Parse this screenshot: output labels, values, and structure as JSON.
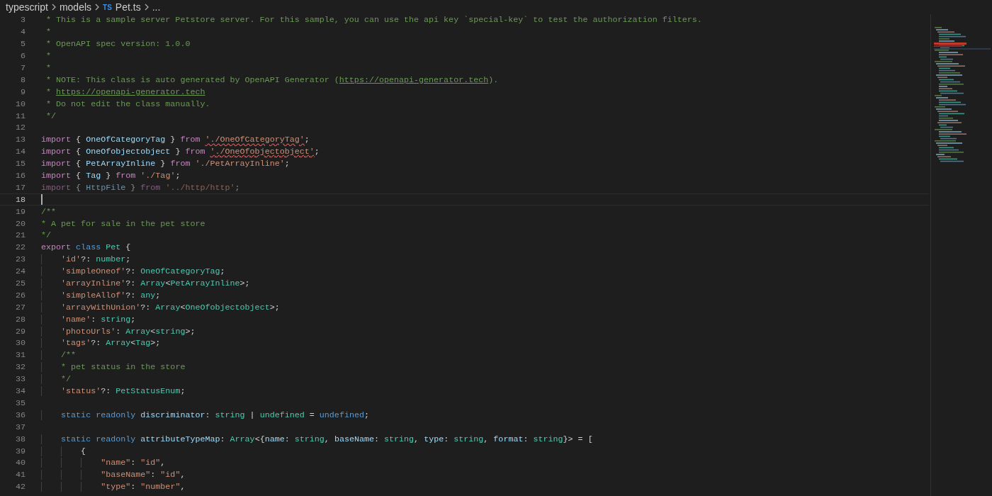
{
  "breadcrumbs": {
    "items": [
      {
        "label": "typescript"
      },
      {
        "label": "models"
      },
      {
        "label": "Pet.ts",
        "badge": "TS"
      },
      {
        "label": "..."
      }
    ]
  },
  "editor": {
    "lines": [
      {
        "number": "3",
        "tokens": [
          {
            "kind": "comment",
            "text": " * This is a sample server Petstore server. For this sample, you can use the api key `special-key` to test the authorization filters."
          }
        ]
      },
      {
        "number": "4",
        "tokens": [
          {
            "kind": "comment",
            "text": " *"
          }
        ]
      },
      {
        "number": "5",
        "tokens": [
          {
            "kind": "comment",
            "text": " * OpenAPI spec version: 1.0.0"
          }
        ]
      },
      {
        "number": "6",
        "tokens": [
          {
            "kind": "comment",
            "text": " *"
          }
        ]
      },
      {
        "number": "7",
        "tokens": [
          {
            "kind": "comment",
            "text": " *"
          }
        ]
      },
      {
        "number": "8",
        "tokens": [
          {
            "kind": "comment",
            "text": " * NOTE: This class is auto generated by OpenAPI Generator ("
          },
          {
            "kind": "link",
            "text": "https://openapi-generator.tech"
          },
          {
            "kind": "comment",
            "text": ")."
          }
        ]
      },
      {
        "number": "9",
        "tokens": [
          {
            "kind": "comment",
            "text": " * "
          },
          {
            "kind": "link",
            "text": "https://openapi-generator.tech"
          }
        ]
      },
      {
        "number": "10",
        "tokens": [
          {
            "kind": "comment",
            "text": " * Do not edit the class manually."
          }
        ]
      },
      {
        "number": "11",
        "tokens": [
          {
            "kind": "comment",
            "text": " */"
          }
        ]
      },
      {
        "number": "12"
      },
      {
        "number": "13",
        "tokens": [
          {
            "kind": "keyword",
            "text": "import"
          },
          {
            "kind": "punct",
            "text": " { "
          },
          {
            "kind": "variable",
            "text": "OneOfCategoryTag"
          },
          {
            "kind": "punct",
            "text": " } "
          },
          {
            "kind": "keyword",
            "text": "from "
          },
          {
            "kind": "error",
            "text": "'./OneOfCategoryTag'"
          },
          {
            "kind": "punct",
            "text": ";"
          }
        ]
      },
      {
        "number": "14",
        "tokens": [
          {
            "kind": "keyword",
            "text": "import"
          },
          {
            "kind": "punct",
            "text": " { "
          },
          {
            "kind": "variable",
            "text": "OneOfobjectobject"
          },
          {
            "kind": "punct",
            "text": " } "
          },
          {
            "kind": "keyword",
            "text": "from "
          },
          {
            "kind": "error",
            "text": "'./OneOfobjectobject'"
          },
          {
            "kind": "punct",
            "text": ";"
          }
        ]
      },
      {
        "number": "15",
        "tokens": [
          {
            "kind": "keyword",
            "text": "import"
          },
          {
            "kind": "punct",
            "text": " { "
          },
          {
            "kind": "variable",
            "text": "PetArrayInline"
          },
          {
            "kind": "punct",
            "text": " } "
          },
          {
            "kind": "keyword",
            "text": "from "
          },
          {
            "kind": "string",
            "text": "'./PetArrayInline'"
          },
          {
            "kind": "punct",
            "text": ";"
          }
        ]
      },
      {
        "number": "16",
        "tokens": [
          {
            "kind": "keyword",
            "text": "import"
          },
          {
            "kind": "punct",
            "text": " { "
          },
          {
            "kind": "variable",
            "text": "Tag"
          },
          {
            "kind": "punct",
            "text": " } "
          },
          {
            "kind": "keyword",
            "text": "from "
          },
          {
            "kind": "string",
            "text": "'./Tag'"
          },
          {
            "kind": "punct",
            "text": ";"
          }
        ]
      },
      {
        "number": "17",
        "unused": true,
        "tokens": [
          {
            "kind": "keyword",
            "text": "import"
          },
          {
            "kind": "punct",
            "text": " { "
          },
          {
            "kind": "variable",
            "text": "HttpFile"
          },
          {
            "kind": "punct",
            "text": " } "
          },
          {
            "kind": "keyword",
            "text": "from "
          },
          {
            "kind": "string",
            "text": "'../http/http'"
          },
          {
            "kind": "punct",
            "text": ";"
          }
        ]
      },
      {
        "number": "18",
        "current": true
      },
      {
        "number": "19",
        "tokens": [
          {
            "kind": "comment",
            "text": "/**"
          }
        ]
      },
      {
        "number": "20",
        "tokens": [
          {
            "kind": "comment",
            "text": "* A pet for sale in the pet store"
          }
        ]
      },
      {
        "number": "21",
        "tokens": [
          {
            "kind": "comment",
            "text": "*/"
          }
        ]
      },
      {
        "number": "22",
        "tokens": [
          {
            "kind": "keyword",
            "text": "export "
          },
          {
            "kind": "storage",
            "text": "class "
          },
          {
            "kind": "type",
            "text": "Pet"
          },
          {
            "kind": "punct",
            "text": " {"
          }
        ]
      },
      {
        "number": "23",
        "tokens": [
          {
            "kind": "string",
            "text": "    'id'"
          },
          {
            "kind": "punct",
            "text": "?: "
          },
          {
            "kind": "type",
            "text": "number"
          },
          {
            "kind": "punct",
            "text": ";"
          }
        ]
      },
      {
        "number": "24",
        "tokens": [
          {
            "kind": "string",
            "text": "    'simpleOneof'"
          },
          {
            "kind": "punct",
            "text": "?: "
          },
          {
            "kind": "type",
            "text": "OneOfCategoryTag"
          },
          {
            "kind": "punct",
            "text": ";"
          }
        ]
      },
      {
        "number": "25",
        "tokens": [
          {
            "kind": "string",
            "text": "    'arrayInline'"
          },
          {
            "kind": "punct",
            "text": "?: "
          },
          {
            "kind": "type",
            "text": "Array"
          },
          {
            "kind": "punct",
            "text": "<"
          },
          {
            "kind": "type",
            "text": "PetArrayInline"
          },
          {
            "kind": "punct",
            "text": ">;"
          }
        ]
      },
      {
        "number": "26",
        "tokens": [
          {
            "kind": "string",
            "text": "    'simpleAllof'"
          },
          {
            "kind": "punct",
            "text": "?: "
          },
          {
            "kind": "type",
            "text": "any"
          },
          {
            "kind": "punct",
            "text": ";"
          }
        ]
      },
      {
        "number": "27",
        "tokens": [
          {
            "kind": "string",
            "text": "    'arrayWithUnion'"
          },
          {
            "kind": "punct",
            "text": "?: "
          },
          {
            "kind": "type",
            "text": "Array"
          },
          {
            "kind": "punct",
            "text": "<"
          },
          {
            "kind": "type",
            "text": "OneOfobjectobject"
          },
          {
            "kind": "punct",
            "text": ">;"
          }
        ]
      },
      {
        "number": "28",
        "tokens": [
          {
            "kind": "string",
            "text": "    'name'"
          },
          {
            "kind": "punct",
            "text": ": "
          },
          {
            "kind": "type",
            "text": "string"
          },
          {
            "kind": "punct",
            "text": ";"
          }
        ]
      },
      {
        "number": "29",
        "tokens": [
          {
            "kind": "string",
            "text": "    'photoUrls'"
          },
          {
            "kind": "punct",
            "text": ": "
          },
          {
            "kind": "type",
            "text": "Array"
          },
          {
            "kind": "punct",
            "text": "<"
          },
          {
            "kind": "type",
            "text": "string"
          },
          {
            "kind": "punct",
            "text": ">;"
          }
        ]
      },
      {
        "number": "30",
        "tokens": [
          {
            "kind": "string",
            "text": "    'tags'"
          },
          {
            "kind": "punct",
            "text": "?: "
          },
          {
            "kind": "type",
            "text": "Array"
          },
          {
            "kind": "punct",
            "text": "<"
          },
          {
            "kind": "type",
            "text": "Tag"
          },
          {
            "kind": "punct",
            "text": ">;"
          }
        ]
      },
      {
        "number": "31",
        "tokens": [
          {
            "kind": "comment",
            "text": "    /**"
          }
        ]
      },
      {
        "number": "32",
        "tokens": [
          {
            "kind": "comment",
            "text": "    * pet status in the store"
          }
        ]
      },
      {
        "number": "33",
        "tokens": [
          {
            "kind": "comment",
            "text": "    */"
          }
        ]
      },
      {
        "number": "34",
        "tokens": [
          {
            "kind": "string",
            "text": "    'status'"
          },
          {
            "kind": "punct",
            "text": "?: "
          },
          {
            "kind": "type",
            "text": "PetStatusEnum"
          },
          {
            "kind": "punct",
            "text": ";"
          }
        ]
      },
      {
        "number": "35"
      },
      {
        "number": "36",
        "tokens": [
          {
            "kind": "storage",
            "text": "    static "
          },
          {
            "kind": "storage",
            "text": "readonly "
          },
          {
            "kind": "variable",
            "text": "discriminator"
          },
          {
            "kind": "punct",
            "text": ": "
          },
          {
            "kind": "type",
            "text": "string"
          },
          {
            "kind": "punct",
            "text": " | "
          },
          {
            "kind": "type",
            "text": "undefined"
          },
          {
            "kind": "punct",
            "text": " = "
          },
          {
            "kind": "storage",
            "text": "undefined"
          },
          {
            "kind": "punct",
            "text": ";"
          }
        ]
      },
      {
        "number": "37"
      },
      {
        "number": "38",
        "tokens": [
          {
            "kind": "storage",
            "text": "    static "
          },
          {
            "kind": "storage",
            "text": "readonly "
          },
          {
            "kind": "variable",
            "text": "attributeTypeMap"
          },
          {
            "kind": "punct",
            "text": ": "
          },
          {
            "kind": "type",
            "text": "Array"
          },
          {
            "kind": "punct",
            "text": "<{"
          },
          {
            "kind": "variable",
            "text": "name"
          },
          {
            "kind": "punct",
            "text": ": "
          },
          {
            "kind": "type",
            "text": "string"
          },
          {
            "kind": "punct",
            "text": ", "
          },
          {
            "kind": "variable",
            "text": "baseName"
          },
          {
            "kind": "punct",
            "text": ": "
          },
          {
            "kind": "type",
            "text": "string"
          },
          {
            "kind": "punct",
            "text": ", "
          },
          {
            "kind": "variable",
            "text": "type"
          },
          {
            "kind": "punct",
            "text": ": "
          },
          {
            "kind": "type",
            "text": "string"
          },
          {
            "kind": "punct",
            "text": ", "
          },
          {
            "kind": "variable",
            "text": "format"
          },
          {
            "kind": "punct",
            "text": ": "
          },
          {
            "kind": "type",
            "text": "string"
          },
          {
            "kind": "punct",
            "text": "}> = ["
          }
        ]
      },
      {
        "number": "39",
        "tokens": [
          {
            "kind": "punct",
            "text": "        {"
          }
        ]
      },
      {
        "number": "40",
        "tokens": [
          {
            "kind": "string",
            "text": "            \"name\""
          },
          {
            "kind": "punct",
            "text": ": "
          },
          {
            "kind": "string",
            "text": "\"id\""
          },
          {
            "kind": "punct",
            "text": ","
          }
        ]
      },
      {
        "number": "41",
        "tokens": [
          {
            "kind": "string",
            "text": "            \"baseName\""
          },
          {
            "kind": "punct",
            "text": ": "
          },
          {
            "kind": "string",
            "text": "\"id\""
          },
          {
            "kind": "punct",
            "text": ","
          }
        ]
      },
      {
        "number": "42",
        "tokens": [
          {
            "kind": "string",
            "text": "            \"type\""
          },
          {
            "kind": "punct",
            "text": ": "
          },
          {
            "kind": "string",
            "text": "\"number\""
          },
          {
            "kind": "punct",
            "text": ","
          }
        ]
      }
    ]
  }
}
